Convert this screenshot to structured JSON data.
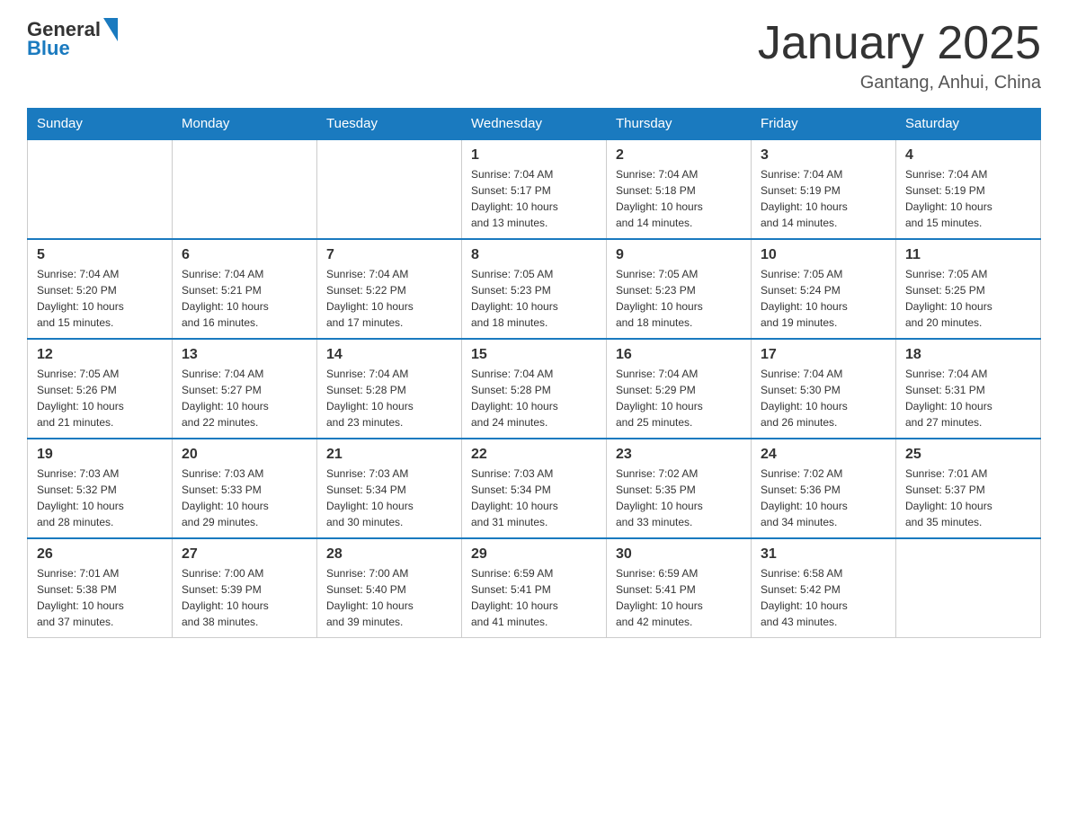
{
  "header": {
    "logo_general": "General",
    "logo_blue": "Blue",
    "title": "January 2025",
    "subtitle": "Gantang, Anhui, China"
  },
  "weekdays": [
    "Sunday",
    "Monday",
    "Tuesday",
    "Wednesday",
    "Thursday",
    "Friday",
    "Saturday"
  ],
  "weeks": [
    [
      {
        "day": "",
        "info": ""
      },
      {
        "day": "",
        "info": ""
      },
      {
        "day": "",
        "info": ""
      },
      {
        "day": "1",
        "info": "Sunrise: 7:04 AM\nSunset: 5:17 PM\nDaylight: 10 hours\nand 13 minutes."
      },
      {
        "day": "2",
        "info": "Sunrise: 7:04 AM\nSunset: 5:18 PM\nDaylight: 10 hours\nand 14 minutes."
      },
      {
        "day": "3",
        "info": "Sunrise: 7:04 AM\nSunset: 5:19 PM\nDaylight: 10 hours\nand 14 minutes."
      },
      {
        "day": "4",
        "info": "Sunrise: 7:04 AM\nSunset: 5:19 PM\nDaylight: 10 hours\nand 15 minutes."
      }
    ],
    [
      {
        "day": "5",
        "info": "Sunrise: 7:04 AM\nSunset: 5:20 PM\nDaylight: 10 hours\nand 15 minutes."
      },
      {
        "day": "6",
        "info": "Sunrise: 7:04 AM\nSunset: 5:21 PM\nDaylight: 10 hours\nand 16 minutes."
      },
      {
        "day": "7",
        "info": "Sunrise: 7:04 AM\nSunset: 5:22 PM\nDaylight: 10 hours\nand 17 minutes."
      },
      {
        "day": "8",
        "info": "Sunrise: 7:05 AM\nSunset: 5:23 PM\nDaylight: 10 hours\nand 18 minutes."
      },
      {
        "day": "9",
        "info": "Sunrise: 7:05 AM\nSunset: 5:23 PM\nDaylight: 10 hours\nand 18 minutes."
      },
      {
        "day": "10",
        "info": "Sunrise: 7:05 AM\nSunset: 5:24 PM\nDaylight: 10 hours\nand 19 minutes."
      },
      {
        "day": "11",
        "info": "Sunrise: 7:05 AM\nSunset: 5:25 PM\nDaylight: 10 hours\nand 20 minutes."
      }
    ],
    [
      {
        "day": "12",
        "info": "Sunrise: 7:05 AM\nSunset: 5:26 PM\nDaylight: 10 hours\nand 21 minutes."
      },
      {
        "day": "13",
        "info": "Sunrise: 7:04 AM\nSunset: 5:27 PM\nDaylight: 10 hours\nand 22 minutes."
      },
      {
        "day": "14",
        "info": "Sunrise: 7:04 AM\nSunset: 5:28 PM\nDaylight: 10 hours\nand 23 minutes."
      },
      {
        "day": "15",
        "info": "Sunrise: 7:04 AM\nSunset: 5:28 PM\nDaylight: 10 hours\nand 24 minutes."
      },
      {
        "day": "16",
        "info": "Sunrise: 7:04 AM\nSunset: 5:29 PM\nDaylight: 10 hours\nand 25 minutes."
      },
      {
        "day": "17",
        "info": "Sunrise: 7:04 AM\nSunset: 5:30 PM\nDaylight: 10 hours\nand 26 minutes."
      },
      {
        "day": "18",
        "info": "Sunrise: 7:04 AM\nSunset: 5:31 PM\nDaylight: 10 hours\nand 27 minutes."
      }
    ],
    [
      {
        "day": "19",
        "info": "Sunrise: 7:03 AM\nSunset: 5:32 PM\nDaylight: 10 hours\nand 28 minutes."
      },
      {
        "day": "20",
        "info": "Sunrise: 7:03 AM\nSunset: 5:33 PM\nDaylight: 10 hours\nand 29 minutes."
      },
      {
        "day": "21",
        "info": "Sunrise: 7:03 AM\nSunset: 5:34 PM\nDaylight: 10 hours\nand 30 minutes."
      },
      {
        "day": "22",
        "info": "Sunrise: 7:03 AM\nSunset: 5:34 PM\nDaylight: 10 hours\nand 31 minutes."
      },
      {
        "day": "23",
        "info": "Sunrise: 7:02 AM\nSunset: 5:35 PM\nDaylight: 10 hours\nand 33 minutes."
      },
      {
        "day": "24",
        "info": "Sunrise: 7:02 AM\nSunset: 5:36 PM\nDaylight: 10 hours\nand 34 minutes."
      },
      {
        "day": "25",
        "info": "Sunrise: 7:01 AM\nSunset: 5:37 PM\nDaylight: 10 hours\nand 35 minutes."
      }
    ],
    [
      {
        "day": "26",
        "info": "Sunrise: 7:01 AM\nSunset: 5:38 PM\nDaylight: 10 hours\nand 37 minutes."
      },
      {
        "day": "27",
        "info": "Sunrise: 7:00 AM\nSunset: 5:39 PM\nDaylight: 10 hours\nand 38 minutes."
      },
      {
        "day": "28",
        "info": "Sunrise: 7:00 AM\nSunset: 5:40 PM\nDaylight: 10 hours\nand 39 minutes."
      },
      {
        "day": "29",
        "info": "Sunrise: 6:59 AM\nSunset: 5:41 PM\nDaylight: 10 hours\nand 41 minutes."
      },
      {
        "day": "30",
        "info": "Sunrise: 6:59 AM\nSunset: 5:41 PM\nDaylight: 10 hours\nand 42 minutes."
      },
      {
        "day": "31",
        "info": "Sunrise: 6:58 AM\nSunset: 5:42 PM\nDaylight: 10 hours\nand 43 minutes."
      },
      {
        "day": "",
        "info": ""
      }
    ]
  ]
}
